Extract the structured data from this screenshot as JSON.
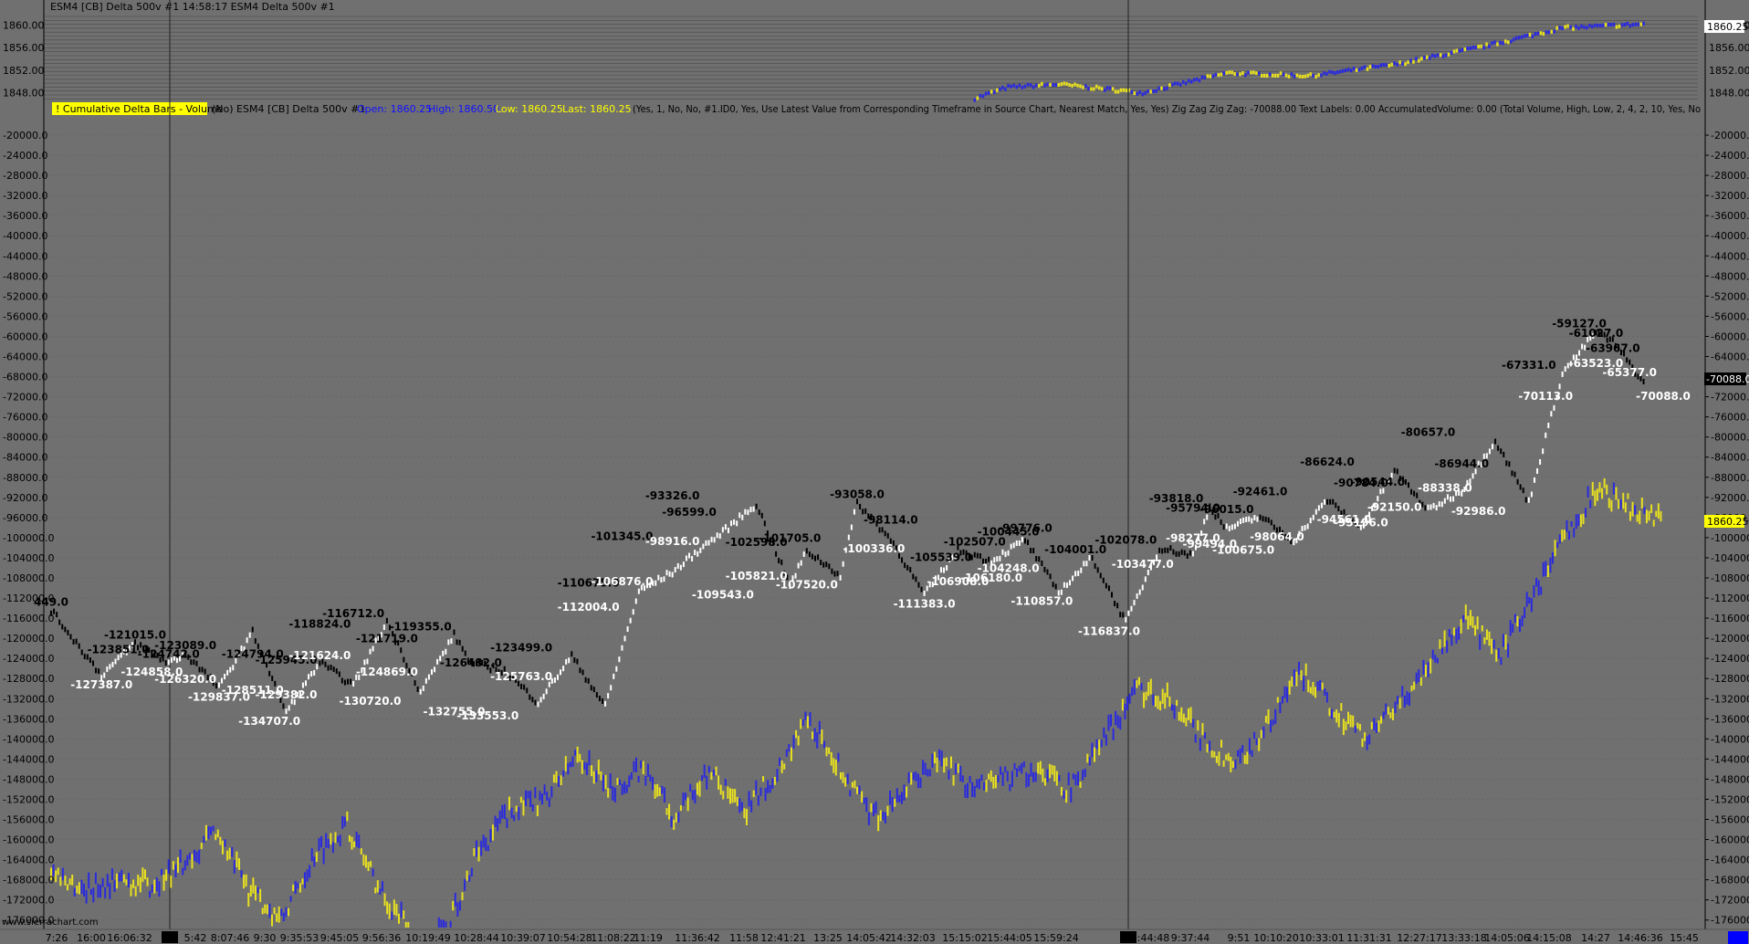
{
  "title": "ESM4 [CB]  Delta 500v  #1 14:58:17 ESM4 Delta 500v  #1",
  "study_bar": {
    "name": "! Cumulative Delta Bars - Volume",
    "pre": "(No)  ESM4 [CB]  Delta 500v  #1",
    "open": "Open: 1860.25",
    "high": "High: 1860.50",
    "low": "Low: 1860.25",
    "last": "Last: 1860.25",
    "params": "(Yes, 1, No, No, #1.ID0, Yes, Use Latest Value from Corresponding Timeframe in Source Chart, Nearest Match, Yes, Yes)  Zig Zag  Zig Zag: -70088.00  Text Labels: 0.00  AccumulatedVolume: 0.00   (Total Volume, High, Low, 2, 4, 2, 10, Yes, No"
  },
  "watermark": "www.sierrachart.com",
  "price_badge_top": "1860.25",
  "price_badge_mid": "1860.25",
  "delta_badge": "-70088.0",
  "colors": {
    "bg": "#707070",
    "up": "#2a2adf",
    "down": "#e8e020",
    "zz_high": "#000000",
    "zz_low": "#ffffff"
  },
  "chart_data": [
    {
      "type": "line",
      "title": "ESM4 [CB] Delta 500v",
      "y_ticks": [
        "1860.00",
        "1856.00",
        "1852.00",
        "1848.00"
      ],
      "ylim": [
        1846.8,
        1862.2
      ],
      "x": [
        0,
        5,
        10,
        15,
        20,
        25,
        30,
        35,
        40,
        45,
        50,
        53,
        55,
        56,
        57,
        60,
        65,
        70,
        75,
        80,
        85,
        90,
        95
      ],
      "values": [
        null,
        null,
        null,
        null,
        null,
        null,
        null,
        null,
        null,
        null,
        null,
        null,
        1847,
        1848,
        1849,
        1849.5,
        1848,
        1851.5,
        1851,
        1853,
        1856,
        1859.5,
        1860.2
      ]
    },
    {
      "type": "line",
      "title": "Cumulative Delta Bars - Volume",
      "y_ticks": [
        "-20000.0",
        "-24000.0",
        "-28000.0",
        "-32000.0",
        "-36000.0",
        "-40000.0",
        "-44000.0",
        "-48000.0",
        "-52000.0",
        "-56000.0",
        "-60000.0",
        "-64000.0",
        "-68000.0",
        "-72000.0",
        "-76000.0",
        "-80000.0",
        "-84000.0",
        "-88000.0",
        "-92000.0",
        "-96000.0",
        "-100000.0",
        "-104000.0",
        "-108000.0",
        "-112000.0",
        "-116000.0",
        "-120000.0",
        "-124000.0",
        "-128000.0",
        "-132000.0",
        "-136000.0",
        "-140000.0",
        "-144000.0",
        "-148000.0",
        "-152000.0",
        "-156000.0",
        "-160000.0",
        "-164000.0",
        "-168000.0",
        "-172000.0",
        "-176000.0"
      ],
      "ylim": [
        -177500,
        -18000
      ],
      "x_labels": [
        "7:26",
        "16:00",
        "16:06:32",
        "5:42",
        "8:07:46",
        "9:30",
        "9:35:53",
        "9:45:05",
        "9:56:36",
        "10:19:49",
        "10:28:44",
        "10:39:07",
        "10:54:28",
        "11:08:22",
        "11:19",
        "11:36:42",
        "11:58",
        "12:41:21",
        "13:25",
        "14:05:42",
        "14:32:03",
        "15:15:02",
        "15:44:05",
        "15:59:24",
        "8:44:48",
        "9:37:44",
        "9:51",
        "10:10:20",
        "10:33:01",
        "11:31:31",
        "12:27:17",
        "13:33:18",
        "14:05:06",
        "14:15:08",
        "14:27",
        "14:46:36",
        "15:45"
      ],
      "session_markers": [
        "4-3",
        "4-9"
      ],
      "zigzag": {
        "x": [
          0,
          3,
          5,
          7,
          8,
          10,
          12,
          14,
          16,
          18,
          20,
          22,
          24,
          25,
          27,
          29,
          31,
          33,
          35,
          37,
          39,
          40,
          42,
          44,
          45,
          47,
          48,
          50,
          52,
          54,
          56,
          58,
          60,
          62,
          64,
          66,
          68,
          69,
          70,
          72,
          74,
          76,
          78,
          80,
          82,
          84,
          86,
          88,
          90,
          92,
          93,
          94,
          95
        ],
        "values": [
          -114449,
          -127387,
          -121015,
          -124858,
          -123089,
          -129837,
          -118824,
          -134707,
          -124794,
          -129382,
          -116712,
          -130720,
          -119355,
          -124869,
          -126482,
          -132755,
          -123499,
          -133553,
          -110675,
          -106876,
          -101345,
          -98916,
          -93326,
          -109543,
          -102598,
          -107520,
          -93058,
          -100336,
          -111383,
          -102507,
          -104668,
          -100445,
          -110857,
          -104001,
          -116837,
          -102078,
          -103477,
          -93818,
          -98277,
          -95794,
          -100675,
          -92461,
          -98064,
          -86624,
          -94561,
          -90784,
          -80657,
          -92986,
          -67331,
          -59127,
          -61027,
          -65377,
          -70088
        ]
      },
      "zigzag_labels": [
        {
          "x": 0,
          "y": -114449,
          "text": "449.0",
          "c": "h"
        },
        {
          "x": 3,
          "y": -127387,
          "text": "-127387.0",
          "c": "l"
        },
        {
          "x": 5,
          "y": -121015,
          "text": "-121015.0",
          "c": "h"
        },
        {
          "x": 4,
          "y": -123851,
          "text": "-123851.0",
          "c": "h"
        },
        {
          "x": 6,
          "y": -124858,
          "text": "-124858.0",
          "c": "l"
        },
        {
          "x": 8,
          "y": -123089,
          "text": "-123089.0",
          "c": "h"
        },
        {
          "x": 7,
          "y": -124742,
          "text": "-124742.0",
          "c": "h"
        },
        {
          "x": 8,
          "y": -126320,
          "text": "-126320.0",
          "c": "l"
        },
        {
          "x": 10,
          "y": -129837,
          "text": "-129837.0",
          "c": "l"
        },
        {
          "x": 12,
          "y": -124794,
          "text": "-124794.0",
          "c": "h"
        },
        {
          "x": 12,
          "y": -128511,
          "text": "-128511.0",
          "c": "l"
        },
        {
          "x": 14,
          "y": -125945,
          "text": "-125945.0",
          "c": "h"
        },
        {
          "x": 14,
          "y": -129382,
          "text": "-129382.0",
          "c": "l"
        },
        {
          "x": 16,
          "y": -118824,
          "text": "-118824.0",
          "c": "h"
        },
        {
          "x": 16,
          "y": -121624,
          "text": "-121624.0",
          "c": "l"
        },
        {
          "x": 13,
          "y": -134707,
          "text": "-134707.0",
          "c": "l"
        },
        {
          "x": 18,
          "y": -116712,
          "text": "-116712.0",
          "c": "h"
        },
        {
          "x": 20,
          "y": -121719,
          "text": "-121719.0",
          "c": "h"
        },
        {
          "x": 20,
          "y": -124869,
          "text": "-124869.0",
          "c": "l"
        },
        {
          "x": 19,
          "y": -130720,
          "text": "-130720.0",
          "c": "l"
        },
        {
          "x": 22,
          "y": -119355,
          "text": "-119355.0",
          "c": "h"
        },
        {
          "x": 25,
          "y": -126482,
          "text": "-126482.0",
          "c": "h"
        },
        {
          "x": 24,
          "y": -132755,
          "text": "-132755.0",
          "c": "l"
        },
        {
          "x": 26,
          "y": -133553,
          "text": "-133553.0",
          "c": "l"
        },
        {
          "x": 28,
          "y": -123499,
          "text": "-123499.0",
          "c": "h"
        },
        {
          "x": 28,
          "y": -125763,
          "text": "-125763.0",
          "c": "l"
        },
        {
          "x": 32,
          "y": -110675,
          "text": "-110675.0",
          "c": "h"
        },
        {
          "x": 32,
          "y": -112004,
          "text": "-112004.0",
          "c": "l"
        },
        {
          "x": 34,
          "y": -101345,
          "text": "-101345.0",
          "c": "h"
        },
        {
          "x": 34,
          "y": -106876,
          "text": "-106876.0",
          "c": "l"
        },
        {
          "x": 37,
          "y": -93326,
          "text": "-93326.0",
          "c": "h"
        },
        {
          "x": 38,
          "y": -96599,
          "text": "-96599.0",
          "c": "h"
        },
        {
          "x": 37,
          "y": -98916,
          "text": "-98916.0",
          "c": "l"
        },
        {
          "x": 40,
          "y": -109543,
          "text": "-109543.0",
          "c": "l"
        },
        {
          "x": 42,
          "y": -102598,
          "text": "-102598.0",
          "c": "h"
        },
        {
          "x": 42,
          "y": -105821,
          "text": "-105821.0",
          "c": "l"
        },
        {
          "x": 44,
          "y": -101705,
          "text": "-101705.0",
          "c": "h"
        },
        {
          "x": 45,
          "y": -107520,
          "text": "-107520.0",
          "c": "l"
        },
        {
          "x": 48,
          "y": -93058,
          "text": "-93058.0",
          "c": "h"
        },
        {
          "x": 50,
          "y": -98114,
          "text": "-98114.0",
          "c": "h"
        },
        {
          "x": 49,
          "y": -100336,
          "text": "-100336.0",
          "c": "l"
        },
        {
          "x": 52,
          "y": -111383,
          "text": "-111383.0",
          "c": "l"
        },
        {
          "x": 53,
          "y": -105539,
          "text": "-105539.0",
          "c": "h"
        },
        {
          "x": 55,
          "y": -102507,
          "text": "-102507.0",
          "c": "h"
        },
        {
          "x": 54,
          "y": -106908,
          "text": "-106908.0",
          "c": "l"
        },
        {
          "x": 56,
          "y": -106180,
          "text": "-106180.0",
          "c": "l"
        },
        {
          "x": 57,
          "y": -100445,
          "text": "-100445.0",
          "c": "h"
        },
        {
          "x": 58,
          "y": -99776,
          "text": "-99776.0",
          "c": "h"
        },
        {
          "x": 57,
          "y": -104248,
          "text": "-104248.0",
          "c": "l"
        },
        {
          "x": 59,
          "y": -110857,
          "text": "-110857.0",
          "c": "l"
        },
        {
          "x": 61,
          "y": -104001,
          "text": "-104001.0",
          "c": "h"
        },
        {
          "x": 63,
          "y": -116837,
          "text": "-116837.0",
          "c": "l"
        },
        {
          "x": 64,
          "y": -102078,
          "text": "-102078.0",
          "c": "h"
        },
        {
          "x": 65,
          "y": -103477,
          "text": "-103477.0",
          "c": "l"
        },
        {
          "x": 67,
          "y": -93818,
          "text": "-93818.0",
          "c": "h"
        },
        {
          "x": 68,
          "y": -95794,
          "text": "-95794.0",
          "c": "h"
        },
        {
          "x": 70,
          "y": -96015,
          "text": "-96015.0",
          "c": "h"
        },
        {
          "x": 68,
          "y": -98277,
          "text": "-98277.0",
          "c": "l"
        },
        {
          "x": 69,
          "y": -99494,
          "text": "-99494.0",
          "c": "l"
        },
        {
          "x": 71,
          "y": -100675,
          "text": "-100675.0",
          "c": "l"
        },
        {
          "x": 72,
          "y": -92461,
          "text": "-92461.0",
          "c": "h"
        },
        {
          "x": 73,
          "y": -98064,
          "text": "-98064.0",
          "c": "l"
        },
        {
          "x": 76,
          "y": -86624,
          "text": "-86624.0",
          "c": "h"
        },
        {
          "x": 78,
          "y": -90784,
          "text": "-90784.0",
          "c": "h"
        },
        {
          "x": 79,
          "y": -90544,
          "text": "-90544.0",
          "c": "h"
        },
        {
          "x": 77,
          "y": -94561,
          "text": "-94561.0",
          "c": "l"
        },
        {
          "x": 78,
          "y": -95196,
          "text": "-95196.0",
          "c": "l"
        },
        {
          "x": 80,
          "y": -92150,
          "text": "-92150.0",
          "c": "l"
        },
        {
          "x": 82,
          "y": -80657,
          "text": "-80657.0",
          "c": "h"
        },
        {
          "x": 84,
          "y": -86944,
          "text": "-86944.0",
          "c": "h"
        },
        {
          "x": 83,
          "y": -88338,
          "text": "-88338.0",
          "c": "l"
        },
        {
          "x": 85,
          "y": -92986,
          "text": "-92986.0",
          "c": "l"
        },
        {
          "x": 88,
          "y": -67331,
          "text": "-67331.0",
          "c": "h"
        },
        {
          "x": 89,
          "y": -70113,
          "text": "-70113.0",
          "c": "l"
        },
        {
          "x": 91,
          "y": -59127,
          "text": "-59127.0",
          "c": "h"
        },
        {
          "x": 92,
          "y": -61027,
          "text": "-61027.0",
          "c": "h"
        },
        {
          "x": 93,
          "y": -63967,
          "text": "-63967.0",
          "c": "h"
        },
        {
          "x": 92,
          "y": -63523,
          "text": "-63523.0",
          "c": "l"
        },
        {
          "x": 94,
          "y": -65377,
          "text": "-65377.0",
          "c": "l"
        },
        {
          "x": 96,
          "y": -70088,
          "text": "-70088.0",
          "c": "l"
        }
      ]
    },
    {
      "type": "line",
      "title": "ESM4 price (overlay)",
      "values": [
        -166000,
        -170000,
        -168000,
        -169000,
        -165000,
        -158000,
        -170000,
        -176000,
        -163000,
        -157000,
        -170000,
        -179000,
        -178000,
        -162000,
        -154000,
        -152000,
        -143000,
        -150000,
        -146000,
        -156000,
        -146000,
        -155000,
        -147000,
        -136000,
        -146000,
        -156000,
        -150000,
        -144000,
        -150000,
        -148000,
        -146000,
        -150000,
        -140000,
        -130000,
        -132000,
        -140000,
        -145000,
        -137000,
        -127000,
        -134000,
        -140000,
        -133000,
        -124000,
        -116000,
        -124000,
        -112000,
        -100000,
        -90000,
        -94000,
        -96000
      ]
    }
  ]
}
